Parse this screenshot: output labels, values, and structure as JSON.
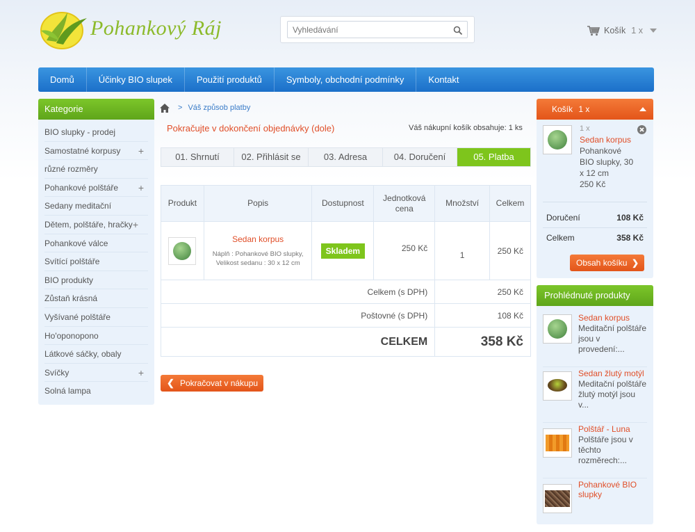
{
  "header": {
    "logo_text": "Pohankový Ráj",
    "search_placeholder": "Vyhledávání",
    "cart_label": "Košík",
    "cart_count": "1 x"
  },
  "nav": {
    "items": [
      "Domů",
      "Účinky BIO slupek",
      "Použití produktů",
      "Symboly, obchodní podmínky",
      "Kontakt"
    ]
  },
  "sidebar": {
    "title": "Kategorie",
    "items": [
      {
        "label": "BIO slupky - prodej",
        "plus": ""
      },
      {
        "label": "Samostatné korpusy",
        "plus": "+"
      },
      {
        "label": "různé rozměry",
        "plus": ""
      },
      {
        "label": "Pohankové polštáře",
        "plus": "+"
      },
      {
        "label": "Sedany meditační",
        "plus": ""
      },
      {
        "label": "Dětem, polštáře, hračky",
        "plus": "+"
      },
      {
        "label": "Pohankové válce",
        "plus": ""
      },
      {
        "label": "Svítící polštáře",
        "plus": ""
      },
      {
        "label": "BIO produkty",
        "plus": ""
      },
      {
        "label": "Zůstaň krásná",
        "plus": ""
      },
      {
        "label": "Vyšívané polštáře",
        "plus": ""
      },
      {
        "label": "Ho'oponopono",
        "plus": ""
      },
      {
        "label": "Látkové sáčky, obaly",
        "plus": ""
      },
      {
        "label": "Svíčky",
        "plus": "+"
      },
      {
        "label": "Solná lampa",
        "plus": ""
      }
    ]
  },
  "breadcrumb": {
    "separator": ">",
    "current": "Váš způsob platby"
  },
  "main": {
    "continue_message": "Pokračujte v dokončení objednávky (dole)",
    "cart_summary": "Váš nákupní košík obsahuje: 1 ks",
    "steps": [
      "01. Shrnutí",
      "02. Přihlásit se",
      "03. Adresa",
      "04. Doručení",
      "05. Platba"
    ],
    "active_step": 4,
    "table": {
      "headers": [
        "Produkt",
        "Popis",
        "Dostupnost",
        "Jednotková cena",
        "Množství",
        "Celkem"
      ],
      "row": {
        "name": "Sedan korpus",
        "description": "Náplň : Pohankové BIO slupky, Velikost sedanu : 30 x 12 cm",
        "availability": "Skladem",
        "unit_price": "250 Kč",
        "quantity": "1",
        "total": "250 Kč"
      },
      "subtotal_label": "Celkem (s DPH)",
      "subtotal_value": "250 Kč",
      "shipping_label": "Poštovné (s DPH)",
      "shipping_value": "108 Kč",
      "grand_label": "CELKEM",
      "grand_value": "358 Kč"
    },
    "back_button": "Pokračovat v nákupu"
  },
  "cart_box": {
    "title": "Košík",
    "count": "1 x",
    "item_qty": "1 x",
    "item_name": "Sedan korpus",
    "item_desc": "Pohankové BIO slupky, 30 x 12 cm",
    "item_price": "250 Kč",
    "delivery_label": "Doručení",
    "delivery_value": "108 Kč",
    "total_label": "Celkem",
    "total_value": "358 Kč",
    "button": "Obsah košíku"
  },
  "recent": {
    "title": "Prohlédnuté produkty",
    "items": [
      {
        "name": "Sedan korpus",
        "desc": "Meditační polštáře jsou v provedení:..."
      },
      {
        "name": "Sedan žlutý motýl",
        "desc": "Meditační polštáře žlutý motýl jsou v..."
      },
      {
        "name": "Polštář - Luna",
        "desc": "Polštáře jsou v těchto rozměrech:..."
      },
      {
        "name": "Pohankové BIO slupky",
        "desc": ""
      }
    ]
  },
  "colors": {
    "nav_blue": "#1b6fc9",
    "green": "#7ec51c",
    "orange": "#e3551a",
    "link_red": "#e04e28"
  }
}
